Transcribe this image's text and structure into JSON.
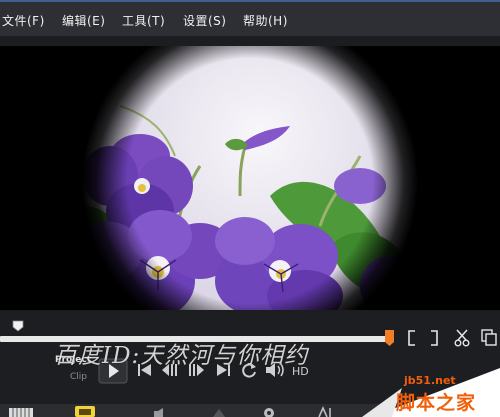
{
  "menu": {
    "file": "文件(F)",
    "edit": "编辑(E)",
    "tools": "工具(T)",
    "settings": "设置(S)",
    "help": "帮助(H)"
  },
  "preview": {
    "content": "vignetted photo of purple violet flowers"
  },
  "playback": {
    "progress": 0.99,
    "mode_project": "Project",
    "mode_clip": "Clip",
    "hd_label": "HD"
  },
  "controls": [
    "play",
    "start",
    "previous-frame",
    "next-frame",
    "end",
    "repeat",
    "volume"
  ],
  "trim_icons": [
    "mark-in",
    "mark-out",
    "cut-scissors",
    "copy"
  ],
  "watermark": {
    "text": "百度ID:天然河与你相约"
  },
  "site_logo": {
    "url": "jb51.net",
    "name": "脚本之家"
  },
  "colors": {
    "accent_orange": "#f07e26",
    "logo_orange": "#f25f0a",
    "menu_bg": "#2d2f34",
    "violet": "#6a3fb4"
  }
}
